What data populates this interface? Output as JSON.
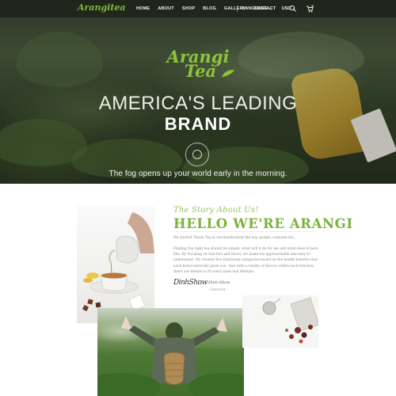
{
  "nav": {
    "logo": "Arangitea",
    "menu": [
      "HOME",
      "ABOUT",
      "SHOP",
      "BLOG",
      "GALLERY",
      "CONTACT"
    ],
    "language": "LANGUAGE ⌄",
    "currency": "USD ⌄",
    "icons": [
      "search-icon",
      "cart-icon"
    ],
    "accent": "#7cb93a"
  },
  "hero": {
    "brand_logo_line1": "Arangi",
    "brand_logo_line2": "Tea",
    "headline_line1": "AMERICA'S LEADING",
    "headline_line2": "BRAND",
    "tagline": "The fog opens up your world early in the morning."
  },
  "story": {
    "script_heading": "The Story About Us!",
    "title": "HELLO WE'RE ARANGI",
    "paragraph1": "We started Tinola Tea in reconsideration the way people consume tea.",
    "paragraph2": "Finding the right tea should be simple, what will it do for me and what does it taste like. By focusing on function and flavor, we make tea approachable and easy to understand. We created five functional categories based on the health benefits that each blend naturally gives you. And with a variety of flavors within each function, there are blends to fit every taste and lifestyle.",
    "signature": "DinhShow",
    "signer_name": "Dinh Show",
    "signer_role": "- Director -",
    "accent": "#7bb33a"
  }
}
